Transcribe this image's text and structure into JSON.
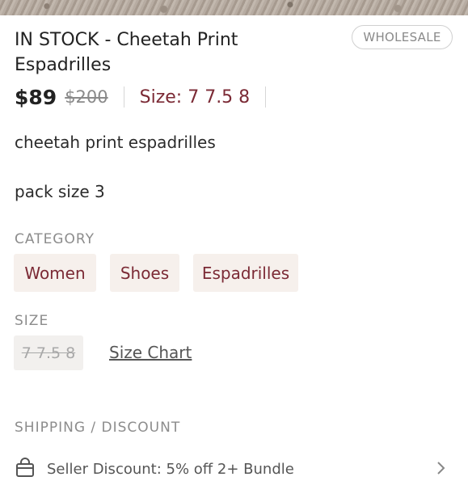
{
  "listing": {
    "title": "IN STOCK - Cheetah Print Espadrilles",
    "badge": "WHOLESALE",
    "price": "$89",
    "original_price": "$200",
    "size_summary": "Size: 7 7.5 8",
    "description": "cheetah print espadrilles",
    "pack_size": "pack size 3"
  },
  "category": {
    "label": "CATEGORY",
    "chips": [
      "Women",
      "Shoes",
      "Espadrilles"
    ]
  },
  "size": {
    "label": "SIZE",
    "value": "7 7.5 8",
    "chart_link": "Size Chart"
  },
  "shipping": {
    "label": "SHIPPING / DISCOUNT",
    "row_text": "Seller Discount: 5% off 2+ Bundle"
  },
  "icons": {
    "shipping": "shopping-bag-icon",
    "row_arrow": "chevron-right-icon"
  },
  "colors": {
    "accent": "#7b2a35",
    "chip_bg": "#f6f0ec",
    "muted": "#8c8c8c"
  }
}
